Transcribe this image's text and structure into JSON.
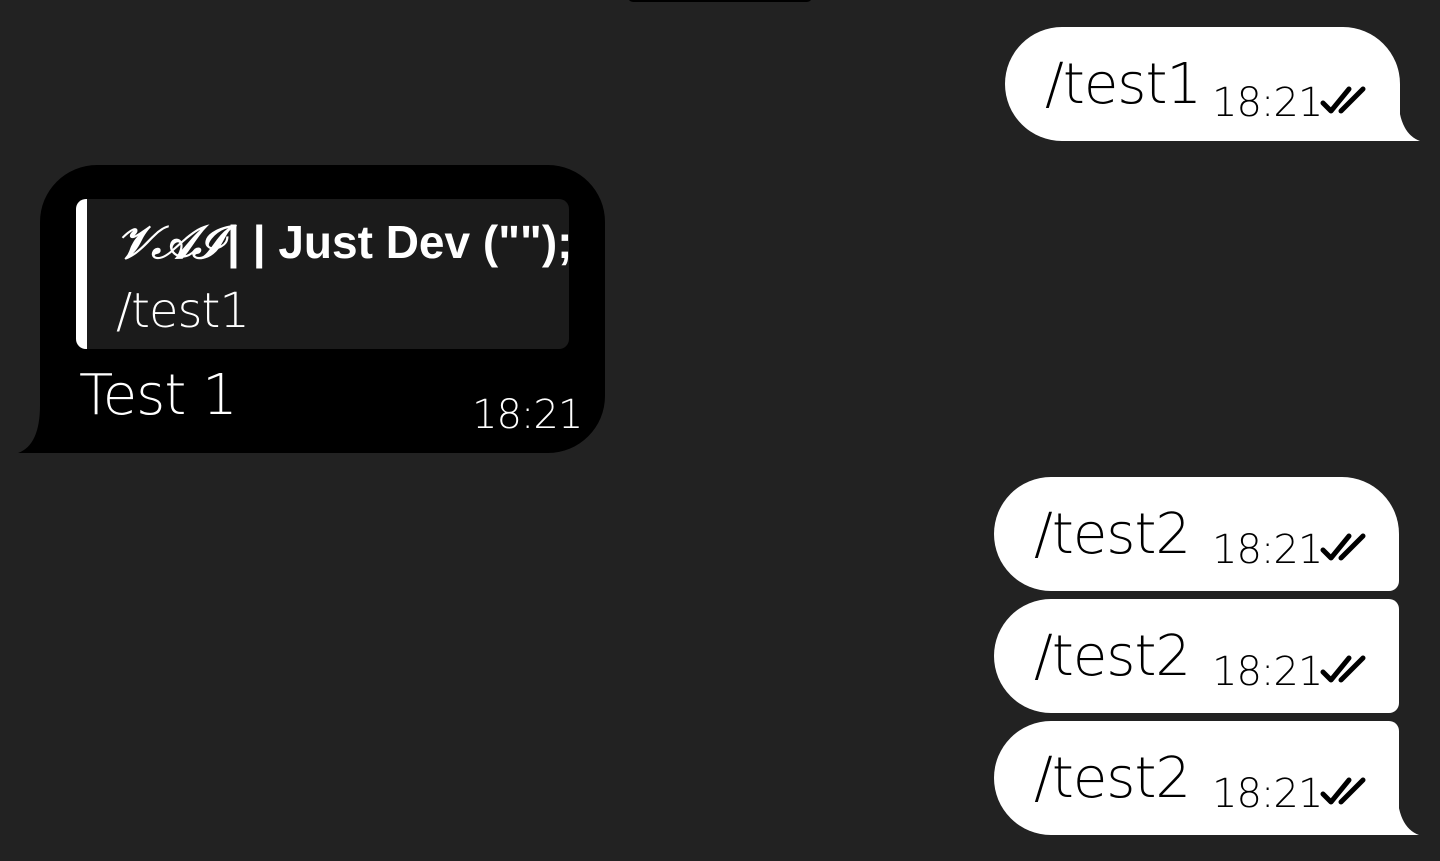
{
  "chat": {
    "messages": [
      {
        "direction": "outgoing",
        "text": "/test1",
        "time": "18:21",
        "status": "read"
      },
      {
        "direction": "incoming",
        "reply": {
          "author_script": "𝒱𝒜ℐ",
          "author": "| | Just Dev (\"\");",
          "text": "/test1"
        },
        "text": "Test 1",
        "time": "18:21"
      },
      {
        "direction": "outgoing",
        "text": "/test2",
        "time": "18:21",
        "status": "read"
      },
      {
        "direction": "outgoing",
        "text": "/test2",
        "time": "18:21",
        "status": "read"
      },
      {
        "direction": "outgoing",
        "text": "/test2",
        "time": "18:21",
        "status": "read"
      }
    ]
  },
  "colors": {
    "background": "#222222",
    "outgoing_bubble": "#ffffff",
    "incoming_bubble": "#000000",
    "reply_background": "#1b1b1b",
    "reply_bar": "#ffffff"
  },
  "icons": {
    "read_receipt": "double-check-icon"
  }
}
